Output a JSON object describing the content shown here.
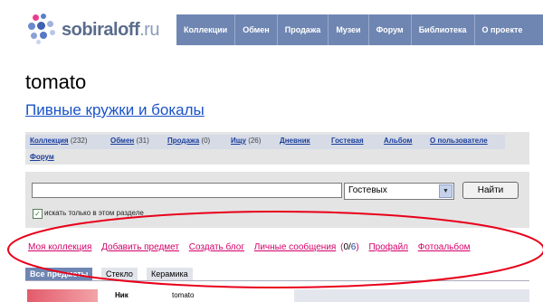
{
  "header": {
    "logo_name": "sobiraloff",
    "logo_tld": ".ru",
    "nav": [
      "Коллекции",
      "Обмен",
      "Продажа",
      "Музеи",
      "Форум",
      "Библиотека",
      "О проекте"
    ]
  },
  "user": {
    "name": "tomato"
  },
  "collection": {
    "title": "Пивные кружки и бокалы"
  },
  "tabs": [
    {
      "label": "Коллекция",
      "count": "(232)"
    },
    {
      "label": "Обмен",
      "count": "(31)"
    },
    {
      "label": "Продажа",
      "count": "(0)"
    },
    {
      "label": "Ищу",
      "count": "(26)"
    },
    {
      "label": "Дневник",
      "count": ""
    },
    {
      "label": "Гостевая",
      "count": ""
    },
    {
      "label": "Альбом",
      "count": ""
    },
    {
      "label": "О пользователе",
      "count": ""
    }
  ],
  "tab_forum": "Форум",
  "search": {
    "value": "",
    "scope_selected": "Гостевых",
    "button": "Найти",
    "checkbox_checked": true,
    "checkbox_label": "искать только в этом разделе"
  },
  "actions": {
    "my_collection": "Моя коллекция",
    "add_item": "Добавить предмет",
    "create_blog": "Создать блог",
    "messages": "Личные сообщения",
    "msg_open": "(",
    "msg_unread": "0",
    "msg_sep": "/",
    "msg_total": "6",
    "msg_close": ")",
    "profile": "Профайл",
    "photo_album": "Фотоальбом"
  },
  "subtabs": [
    "Все предметы",
    "Стекло",
    "Керамика"
  ],
  "profile": {
    "nick_label": "Ник",
    "nick_value": "tomato"
  },
  "colors": {
    "nav": "#6f86b2",
    "accent_links": "#d4006a",
    "highlight_ellipse": "#e8001a"
  }
}
